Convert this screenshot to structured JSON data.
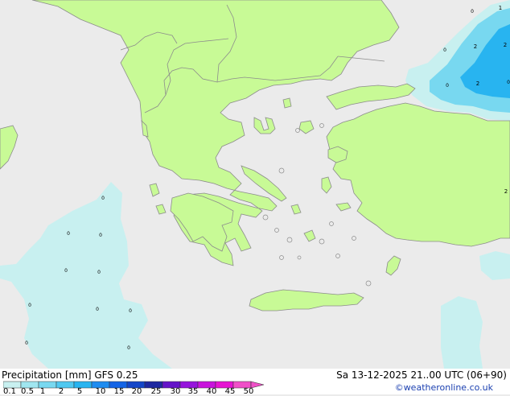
{
  "footer": {
    "title": "Precipitation [mm]  GFS 0.25",
    "datetime": "Sa 13-12-2025 21..00 UTC (06+90)",
    "credit": "©weatheronline.co.uk"
  },
  "legend": {
    "ticks": [
      "0.1",
      "0.5",
      "1",
      "2",
      "5",
      "10",
      "15",
      "20",
      "25",
      "30",
      "35",
      "40",
      "45",
      "50"
    ],
    "colors": [
      "#c8f0f0",
      "#a0e6f0",
      "#78d8f0",
      "#50c8f0",
      "#28b4f0",
      "#1e8cf0",
      "#1464e6",
      "#1446c8",
      "#1e28a0",
      "#6414c8",
      "#9614dc",
      "#c814dc",
      "#e614d2",
      "#f050c8"
    ]
  },
  "map": {
    "colors": {
      "sea": "#ebebeb",
      "land": "#c8fa96",
      "border": "#8c8c8c",
      "precip_light": "#c8f0f0",
      "precip_mid": "#78d8f0",
      "precip_heavy": "#28b4f0"
    },
    "value_labels": [
      "1",
      "2",
      "2",
      "2",
      "2",
      "0",
      "0",
      "0",
      "0",
      "0",
      "0",
      "0",
      "0",
      "0",
      "0",
      "0",
      "0",
      "0",
      "0"
    ]
  }
}
